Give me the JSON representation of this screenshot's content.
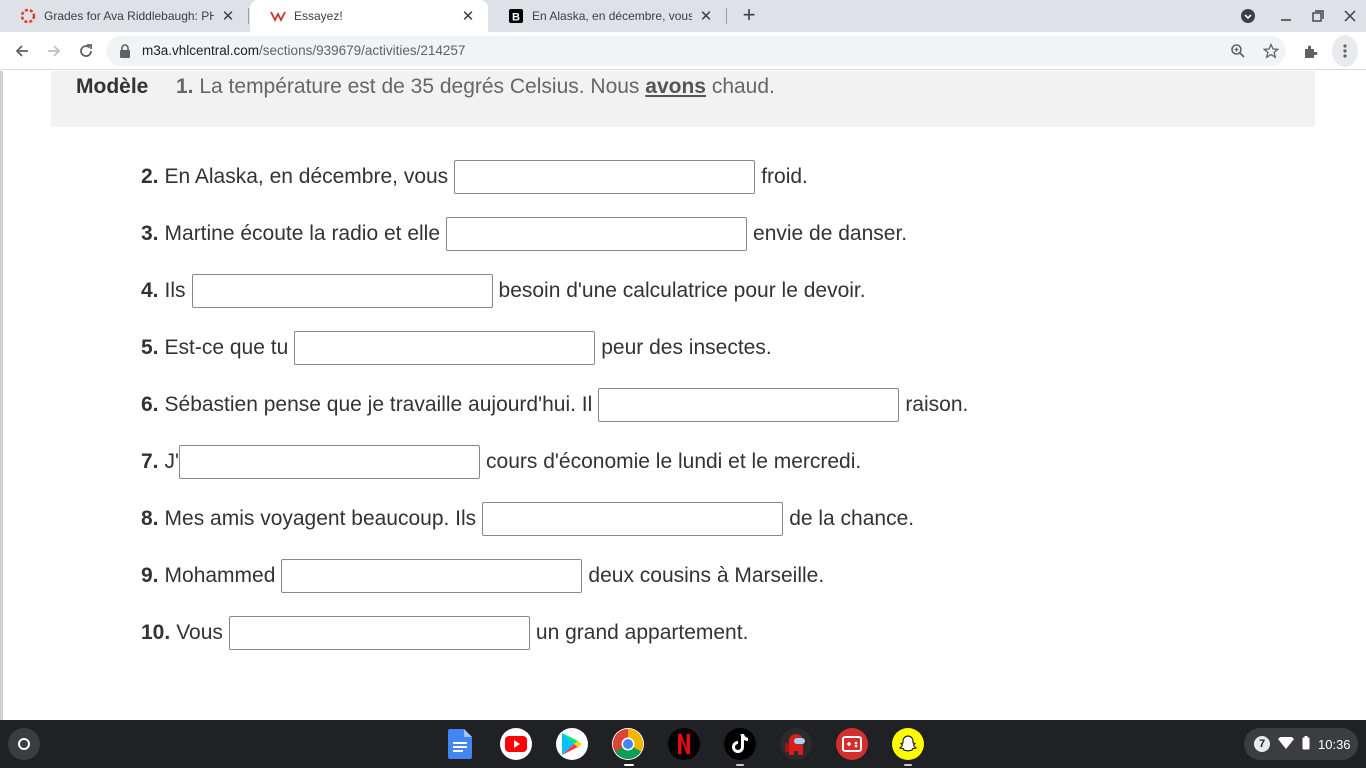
{
  "browser": {
    "tabs": [
      {
        "title": "Grades for Ava Riddlebaugh: PH",
        "icon": "canvas-icon"
      },
      {
        "title": "Essayez!",
        "icon": "vhl-icon"
      },
      {
        "title": "En Alaska, en décembre, vous fr",
        "icon": "brainly-icon"
      }
    ],
    "url_host": "m3a.vhlcentral.com",
    "url_path": "/sections/939679/activities/214257"
  },
  "model": {
    "label": "Modèle",
    "number": "1.",
    "text_before": "La température est de 35 degrés Celsius. Nous",
    "answer": "avons",
    "text_after": "chaud."
  },
  "questions": [
    {
      "num": "2.",
      "before": "En Alaska, en décembre, vous",
      "after": "froid.",
      "value": ""
    },
    {
      "num": "3.",
      "before": "Martine écoute la radio et elle",
      "after": "envie de danser.",
      "value": ""
    },
    {
      "num": "4.",
      "before": "Ils",
      "after": "besoin d'une calculatrice pour le devoir.",
      "value": ""
    },
    {
      "num": "5.",
      "before": "Est-ce que tu",
      "after": "peur des insectes.",
      "value": ""
    },
    {
      "num": "6.",
      "before": "Sébastien pense que je travaille aujourd'hui. Il",
      "after": "raison.",
      "value": ""
    },
    {
      "num": "7.",
      "before": "J'",
      "after": "cours d'économie le lundi et le mercredi.",
      "value": ""
    },
    {
      "num": "8.",
      "before": "Mes amis voyagent beaucoup. Ils",
      "after": "de la chance.",
      "value": ""
    },
    {
      "num": "9.",
      "before": "Mohammed",
      "after": "deux cousins à Marseille.",
      "value": ""
    },
    {
      "num": "10.",
      "before": "Vous",
      "after": "un grand appartement.",
      "value": ""
    }
  ],
  "shelf": {
    "apps": [
      "google-docs-icon",
      "youtube-icon",
      "play-store-icon",
      "chrome-icon",
      "netflix-icon",
      "tiktok-icon",
      "among-us-icon",
      "game-icon",
      "snapchat-icon"
    ],
    "notification_count": "7",
    "time": "10:36"
  }
}
